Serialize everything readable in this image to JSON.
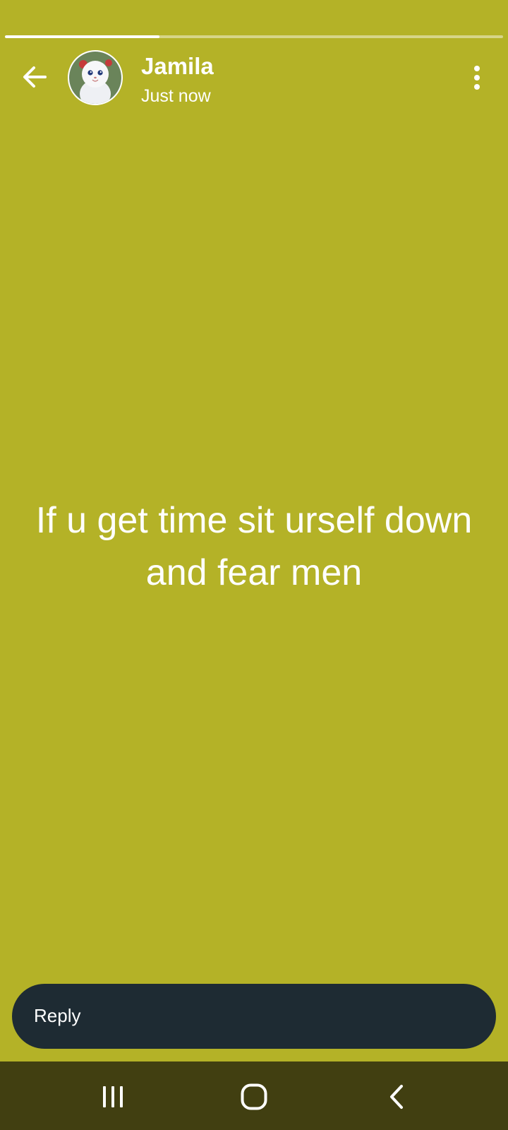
{
  "story": {
    "progress": 0.31,
    "background_color": "#b4b227",
    "text": "If u get time sit urself down and fear men"
  },
  "header": {
    "back_icon": "arrow-left-icon",
    "avatar": "profile-avatar",
    "name": "Jamila",
    "time": "Just now",
    "menu_icon": "more-vert-icon"
  },
  "reply": {
    "placeholder": "Reply"
  },
  "navigation": {
    "recent_icon": "recent-apps-icon",
    "home_icon": "home-icon",
    "back_icon": "back-icon"
  }
}
